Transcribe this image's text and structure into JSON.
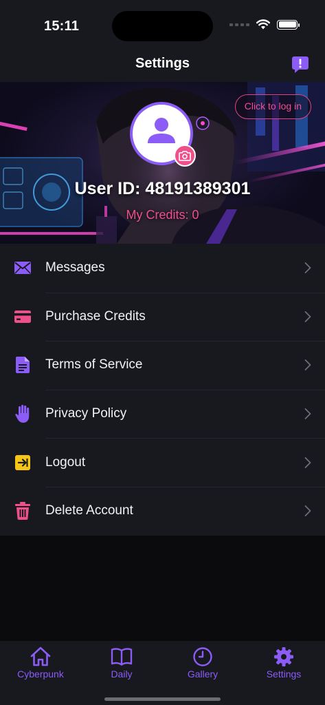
{
  "status_bar": {
    "time": "15:11"
  },
  "header": {
    "title": "Settings",
    "feedback_icon": "exclamation-bubble-icon"
  },
  "profile": {
    "login_label": "Click to log in",
    "user_id": "User ID: 48191389301",
    "credits": "My Credits: 0"
  },
  "menu": {
    "items": [
      {
        "label": "Messages",
        "icon": "envelope-icon",
        "color": "#8b5cf6"
      },
      {
        "label": "Purchase Credits",
        "icon": "credit-card-icon",
        "color": "#f0508a"
      },
      {
        "label": "Terms of Service",
        "icon": "document-icon",
        "color": "#8b5cf6"
      },
      {
        "label": "Privacy Policy",
        "icon": "hand-icon",
        "color": "#8b5cf6"
      },
      {
        "label": "Logout",
        "icon": "logout-arrow-icon",
        "color": "#f5c518"
      },
      {
        "label": "Delete Account",
        "icon": "trash-icon",
        "color": "#f0508a"
      }
    ]
  },
  "tab_bar": {
    "active": "Settings",
    "tabs": [
      {
        "label": "Cyberpunk",
        "icon": "home-icon"
      },
      {
        "label": "Daily",
        "icon": "book-icon"
      },
      {
        "label": "Gallery",
        "icon": "clock-icon"
      },
      {
        "label": "Settings",
        "icon": "gear-icon"
      }
    ]
  },
  "colors": {
    "accent": "#8b5cf6",
    "pink": "#ef4f8e",
    "background": "#18181f"
  }
}
